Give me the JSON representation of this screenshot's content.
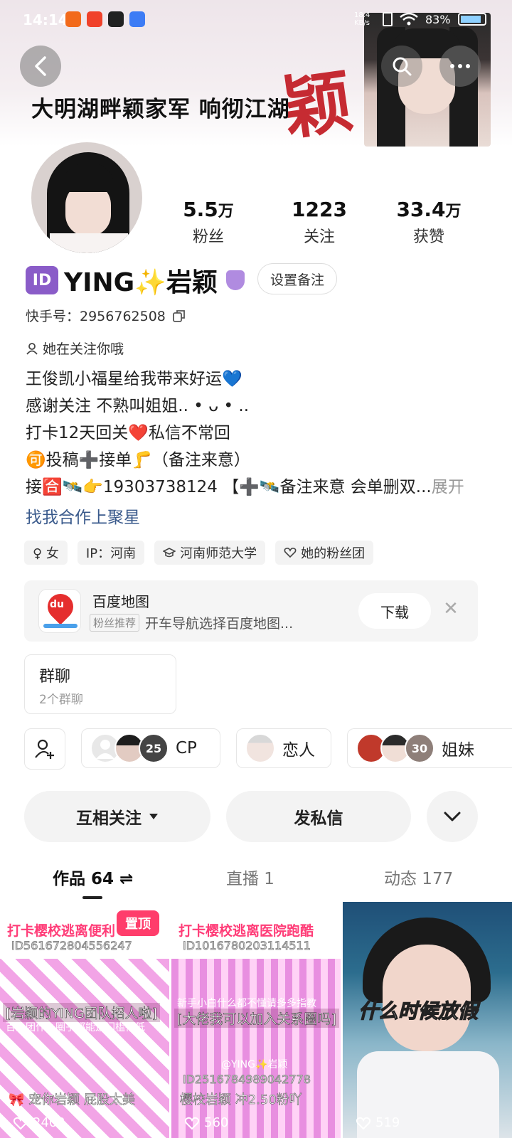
{
  "status_bar": {
    "time": "14:14",
    "net_speed": "18.4 KB/s",
    "battery": "83%",
    "app_colors": [
      "#f26a1b",
      "#f0412a",
      "#222222",
      "#3d7cf5"
    ]
  },
  "banner": {
    "slogan": "大明湖畔颖家军 响彻江湖",
    "big_char": "颖"
  },
  "profile": {
    "id_badge": "ID",
    "name": "YING✨岩颖",
    "remark_button": "设置备注",
    "kuaishou_id": "快手号：2956762508",
    "follows_you": "她在关注你哦",
    "stats": [
      {
        "num": "5.5",
        "unit": "万",
        "label": "粉丝"
      },
      {
        "num": "1223",
        "unit": "",
        "label": "关注"
      },
      {
        "num": "33.4",
        "unit": "万",
        "label": "获赞"
      }
    ],
    "bio": [
      "王俊凯小福星给我带来好运💙",
      "感谢关注 不熟叫姐姐.. • ᴗ • ..",
      "打卡12天回关❤️私信不常回",
      "🉑投稿➕接单🦵（备注来意）",
      "接🈴🛰️👉19303738124 【➕🛰️备注来意 会单删双..."
    ],
    "bio_expand": "展开",
    "find_me": "找我合作上聚星",
    "tags": [
      "♀ 女",
      "IP：河南",
      "河南师范大学",
      "她的粉丝团"
    ]
  },
  "ad": {
    "title": "百度地图",
    "tag": "粉丝推荐",
    "desc": "开车导航选择百度地图...",
    "download": "下载",
    "logo_text": "du"
  },
  "group_chat": {
    "title": "群聊",
    "sub": "2个群聊"
  },
  "relations": [
    {
      "count": "25",
      "label": "CP"
    },
    {
      "count": "",
      "label": "恋人"
    },
    {
      "count": "30",
      "label": "姐妹"
    }
  ],
  "actions": {
    "follow": "互相关注",
    "message": "发私信"
  },
  "tabs": [
    {
      "label": "作品 64 ⇌"
    },
    {
      "label": "直播 1"
    },
    {
      "label": "动态 177"
    }
  ],
  "posts": [
    {
      "headline": "打卡樱校逃离便利",
      "id_line": "ID561672804556247",
      "caption": "[岩颖的YING团队招人啦]",
      "caption2": "百人团什么圈子都能进门槛很低",
      "bottom": "🎀 宠你岩颖 屁股太美",
      "likes": "2402",
      "pinned": "置顶"
    },
    {
      "headline": "打卡樱校逃离医院跑酷",
      "id_line": "ID1016780203114511",
      "caption": "[大佬我可以加入关系圈吗]",
      "caption2": "新手小白什么都不懂请多多指教",
      "bottom": "樱校岩颖 冲2.50粉吖",
      "watermark": "@YING✨岩颖",
      "id_line2": "ID2516784989042778",
      "likes": "560"
    },
    {
      "headline": "什么时候放假",
      "likes": "519"
    }
  ]
}
